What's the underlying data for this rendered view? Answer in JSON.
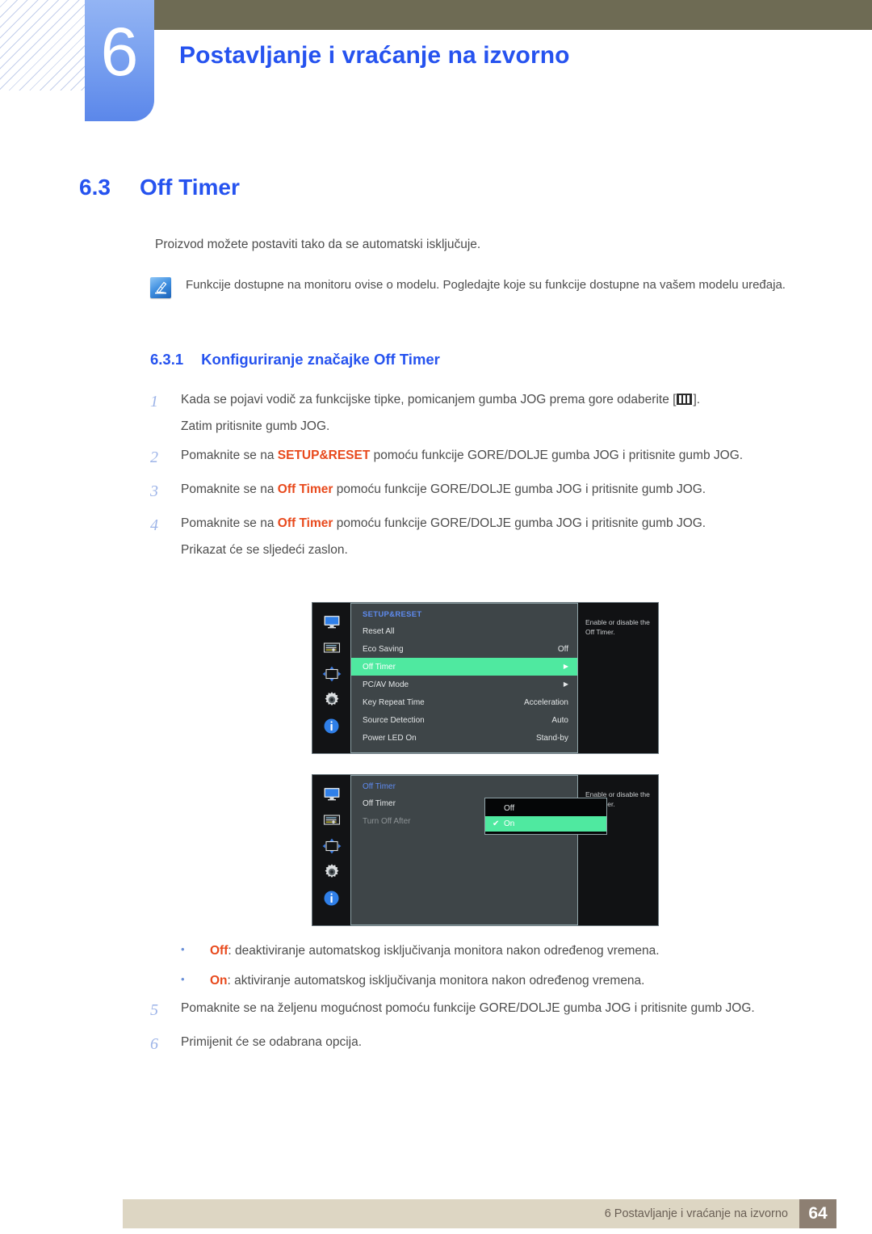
{
  "header": {
    "chapter_number": "6",
    "chapter_title": "Postavljanje i vraćanje na izvorno"
  },
  "section": {
    "number": "6.3",
    "title": "Off Timer",
    "intro": "Proizvod možete postaviti tako da se automatski isključuje."
  },
  "note": {
    "icon": "note-pen-icon",
    "text": "Funkcije dostupne na monitoru ovise o modelu. Pogledajte koje su funkcije dostupne na vašem modelu uređaja."
  },
  "subsection": {
    "number": "6.3.1",
    "title": "Konfiguriranje značajke Off Timer"
  },
  "steps": [
    {
      "num": "1",
      "pre": "Kada se pojavi vodič za funkcijske tipke, pomicanjem gumba JOG prema gore odaberite [",
      "glyph": "menu-bars-icon",
      "post": "].",
      "line2": "Zatim pritisnite gumb JOG."
    },
    {
      "num": "2",
      "pre": "Pomaknite se na ",
      "highlight": "SETUP&RESET",
      "post": " pomoću funkcije GORE/DOLJE gumba JOG i pritisnite gumb JOG.",
      "line2": ""
    },
    {
      "num": "3",
      "pre": "Pomaknite se na ",
      "highlight": "Off Timer",
      "post": " pomoću funkcije GORE/DOLJE gumba JOG i pritisnite gumb JOG.",
      "line2": ""
    },
    {
      "num": "4",
      "pre": "Pomaknite se na ",
      "highlight": "Off Timer",
      "post": " pomoću funkcije GORE/DOLJE gumba JOG i pritisnite gumb JOG.",
      "line2": "Prikazat će se sljedeći zaslon."
    }
  ],
  "osd_menus": [
    {
      "title": "SETUP&RESET",
      "rail_icons": [
        "monitor-icon",
        "sliders-icon",
        "arrows-move-icon",
        "gear-icon",
        "info-icon"
      ],
      "rows": [
        {
          "label": "Reset All",
          "value": "",
          "arrow": false,
          "selected": false,
          "dim": false
        },
        {
          "label": "Eco Saving",
          "value": "Off",
          "arrow": false,
          "selected": false,
          "dim": false
        },
        {
          "label": "Off Timer",
          "value": "",
          "arrow": true,
          "selected": true,
          "dim": false
        },
        {
          "label": "PC/AV Mode",
          "value": "",
          "arrow": true,
          "selected": false,
          "dim": false
        },
        {
          "label": "Key Repeat Time",
          "value": "Acceleration",
          "arrow": false,
          "selected": false,
          "dim": false
        },
        {
          "label": "Source Detection",
          "value": "Auto",
          "arrow": false,
          "selected": false,
          "dim": false
        },
        {
          "label": "Power LED On",
          "value": "Stand-by",
          "arrow": false,
          "selected": false,
          "dim": false
        }
      ],
      "help": "Enable or disable the Off Timer."
    },
    {
      "title": "Off Timer",
      "rail_icons": [
        "monitor-icon",
        "sliders-icon",
        "arrows-move-icon",
        "gear-icon",
        "info-icon"
      ],
      "rows": [
        {
          "label": "Off Timer",
          "value": "",
          "arrow": false,
          "selected": false,
          "dim": false
        },
        {
          "label": "Turn Off After",
          "value": "",
          "arrow": false,
          "selected": false,
          "dim": true
        }
      ],
      "dropdown": [
        {
          "label": "Off",
          "checked": false,
          "selected": false
        },
        {
          "label": "On",
          "checked": true,
          "selected": true
        }
      ],
      "check_glyph": "✔",
      "help": "Enable or disable the Off Timer."
    }
  ],
  "bullets": [
    {
      "dot": "•",
      "term": "Off",
      "text": ": deaktiviranje automatskog isključivanja monitora nakon određenog vremena."
    },
    {
      "dot": "•",
      "term": "On",
      "text": ": aktiviranje automatskog isključivanja monitora nakon određenog vremena."
    }
  ],
  "steps2": [
    {
      "num": "5",
      "pre": "Pomaknite se na željenu mogućnost pomoću funkcije GORE/DOLJE gumba JOG i pritisnite gumb JOG.",
      "line2": ""
    },
    {
      "num": "6",
      "pre": "Primijenit će se odabrana opcija.",
      "line2": ""
    }
  ],
  "footer": {
    "text": "6 Postavljanje i vraćanje na izvorno",
    "page": "64"
  },
  "colors": {
    "heading_blue": "#2653ef",
    "olive_bar": "#6e6b54",
    "highlight_red": "#e8491c",
    "osd_green": "#4fe9a0",
    "footer_beige": "#ddd6c3",
    "footer_page_box": "#8d7f72"
  }
}
